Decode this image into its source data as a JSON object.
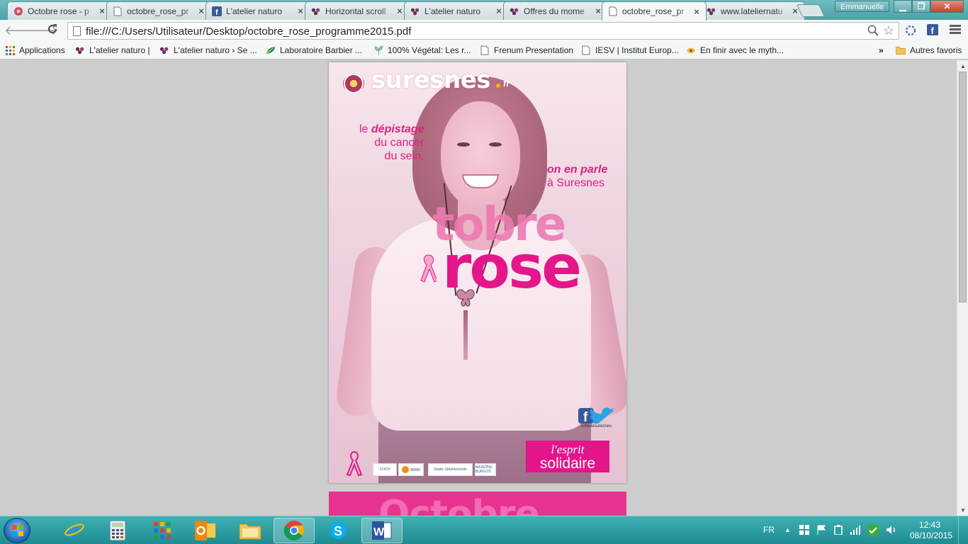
{
  "window": {
    "user_name": "Emmanuelle",
    "tabs": [
      {
        "title": "Octobre rose - p",
        "icon": "flower-icon",
        "active": false
      },
      {
        "title": "octobre_rose_pr",
        "icon": "page-icon",
        "active": false
      },
      {
        "title": "L'atelier naturo",
        "icon": "facebook-icon",
        "active": false
      },
      {
        "title": "Horizontal scroll",
        "icon": "atelier-icon",
        "active": false
      },
      {
        "title": "L'atelier naturo",
        "icon": "atelier-icon",
        "active": false
      },
      {
        "title": "Offres du mome",
        "icon": "atelier-icon",
        "active": false
      },
      {
        "title": "octobre_rose_pr",
        "icon": "page-icon",
        "active": true
      },
      {
        "title": "www.lateliernatu",
        "icon": "atelier-icon",
        "active": false
      }
    ]
  },
  "toolbar": {
    "url": "file:///C:/Users/Utilisateur/Desktop/octobre_rose_programme2015.pdf"
  },
  "bookmarks": {
    "items": [
      {
        "label": "Applications",
        "icon": "apps-grid-icon"
      },
      {
        "label": "L'atelier naturo |",
        "icon": "atelier-icon"
      },
      {
        "label": "L'atelier naturo › Se ...",
        "icon": "atelier-icon"
      },
      {
        "label": "Laboratoire Barbier ...",
        "icon": "leaf-icon"
      },
      {
        "label": "100% Végétal: Les r...",
        "icon": "plant-icon"
      },
      {
        "label": "Frenum Presentation",
        "icon": "page-icon"
      },
      {
        "label": "IESV | Institut Europ...",
        "icon": "page-icon"
      },
      {
        "label": "En finir avec le myth...",
        "icon": "eye-icon"
      }
    ],
    "overflow": "»",
    "other_folder": "Autres favoris"
  },
  "poster": {
    "logo": "suresnes",
    "logo_suffix": "fr",
    "tagline_1": [
      "le",
      "dépistage",
      "du cancer",
      "du sein,"
    ],
    "tagline_2": [
      "on en parle",
      "à Suresnes"
    ],
    "title_line1": "tobre",
    "title_line2": "rose",
    "social_handle": "/villedesuresnes",
    "slogan_1": "l'esprit",
    "slogan_2": "solidaire",
    "partners": [
      "FOCH",
      "Studio Stéphenmode",
      "MAISONS BURGOS"
    ]
  },
  "page2": {
    "title": "Octobre"
  },
  "taskbar": {
    "language": "FR",
    "time": "12:43",
    "date": "08/10/2015",
    "apps": [
      {
        "name": "ie-icon",
        "active": false
      },
      {
        "name": "calculator-icon",
        "active": false
      },
      {
        "name": "apps-grid-icon",
        "active": false
      },
      {
        "name": "outlook-icon",
        "active": false
      },
      {
        "name": "explorer-icon",
        "active": false
      },
      {
        "name": "chrome-icon",
        "active": true
      },
      {
        "name": "skype-icon",
        "active": false
      },
      {
        "name": "word-icon",
        "active": false
      }
    ]
  },
  "colors": {
    "accent_pink": "#e4168a",
    "light_pink": "#ec7ab3",
    "taskbar": "#2a9ca1",
    "tab_strip": "#5db0b5"
  }
}
